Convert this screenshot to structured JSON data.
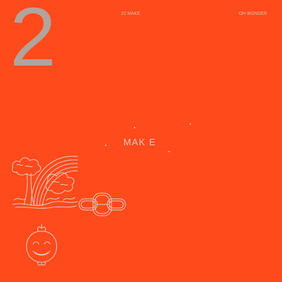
{
  "cover": {
    "background_color": "#ff4a1c",
    "ink_color": "#b3a39a",
    "light_ink_color": "#d9c9bf",
    "big_number": "2",
    "top_left_text": "22 MAKE",
    "top_right_text": "OH WONDER",
    "center_text": "MAK E"
  },
  "icons": [
    "tree-with-rainbow-icon",
    "chain-link-icon",
    "smiling-tomato-icon"
  ]
}
